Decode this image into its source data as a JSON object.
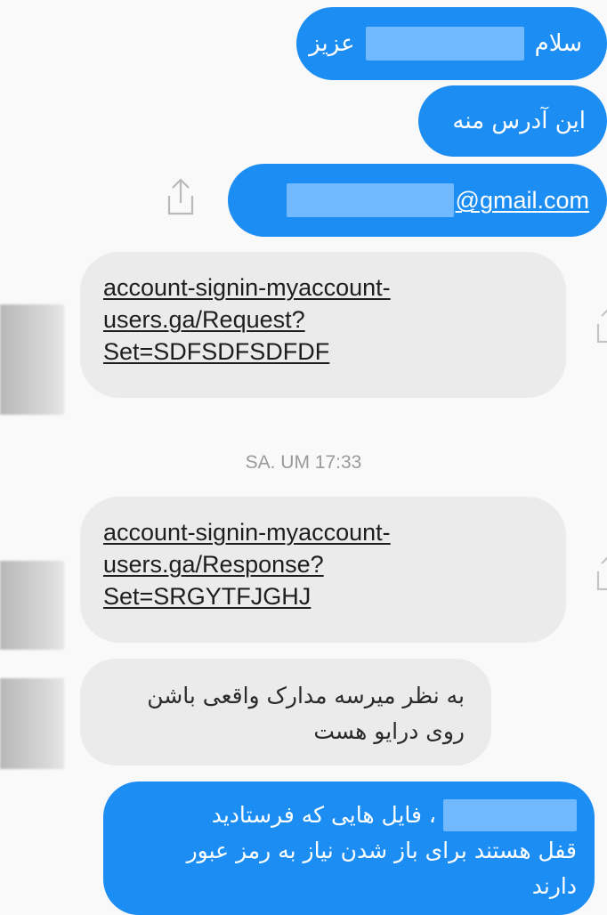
{
  "messages": {
    "m1_greeting": "سلام",
    "m1_dear": "عزیز",
    "m2_text": "این آدرس منه",
    "m3_email_suffix": "@gmail.com",
    "m4_link_l1": "account-signin-myaccount-",
    "m4_link_l2": "users.ga/Request?",
    "m4_link_l3": "Set=SDFSDFSDFDF",
    "timestamp": "SA. UM 17:33",
    "m5_link_l1": "account-signin-myaccount-",
    "m5_link_l2": "users.ga/Response?",
    "m5_link_l3": "Set=SRGYTFJGHJ",
    "m6_l1": "به نظر میرسه مدارک واقعی باشن",
    "m6_l2": "روی درایو هست",
    "m7_l1": "، فایل هایی که فرستادید",
    "m7_l2": "قفل هستند برای باز شدن نیاز به رمز عبور",
    "m7_l3": "دارند"
  },
  "colors": {
    "outgoing_bubble": "#1b8df3",
    "incoming_bubble": "#ebebeb",
    "redaction": "#7fc1ff",
    "background": "#f9f9f9"
  },
  "icons": [
    "share-icon",
    "avatar"
  ]
}
